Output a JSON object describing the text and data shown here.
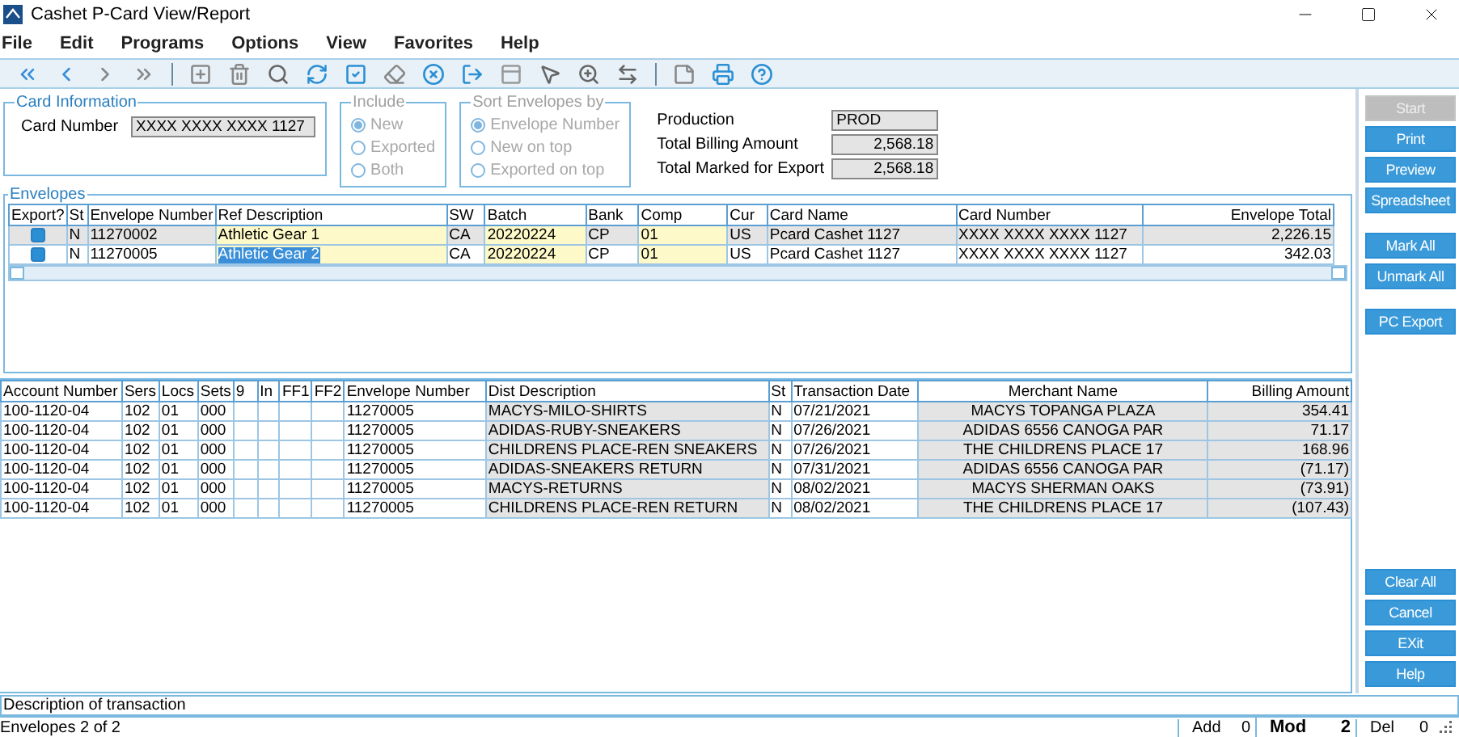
{
  "window": {
    "title": "Cashet P-Card View/Report"
  },
  "menu": [
    "File",
    "Edit",
    "Programs",
    "Options",
    "View",
    "Favorites",
    "Help"
  ],
  "card_information": {
    "title": "Card Information",
    "label": "Card Number",
    "value": "XXXX XXXX XXXX 1127"
  },
  "include": {
    "title": "Include",
    "disabled": true,
    "options": [
      {
        "label": "New",
        "selected": true
      },
      {
        "label": "Exported",
        "selected": false
      },
      {
        "label": "Both",
        "selected": false
      }
    ]
  },
  "sort": {
    "title": "Sort Envelopes by",
    "disabled": true,
    "options": [
      {
        "label": "Envelope Number",
        "selected": true
      },
      {
        "label": "New on top",
        "selected": false
      },
      {
        "label": "Exported on top",
        "selected": false
      }
    ]
  },
  "summary": [
    {
      "label": "Production",
      "value": "PROD"
    },
    {
      "label": "Total Billing Amount",
      "value": "2,568.18"
    },
    {
      "label": "Total Marked for Export",
      "value": "2,568.18"
    }
  ],
  "envelopes": {
    "title": "Envelopes",
    "columns": [
      {
        "label": "Export?",
        "editable": false
      },
      {
        "label": "St",
        "editable": false
      },
      {
        "label": "Envelope Number",
        "editable": false
      },
      {
        "label": "Ref Description",
        "editable": true
      },
      {
        "label": "SW",
        "editable": false
      },
      {
        "label": "Batch",
        "editable": true
      },
      {
        "label": "Bank",
        "editable": false
      },
      {
        "label": "Comp",
        "editable": true
      },
      {
        "label": "Cur",
        "editable": false
      },
      {
        "label": "Card Name",
        "editable": false
      },
      {
        "label": "Card Number",
        "editable": false
      },
      {
        "label": "Envelope Total",
        "editable": false
      }
    ],
    "rows": [
      {
        "selected": false,
        "export": true,
        "cells": [
          "",
          "N",
          "11270002",
          "Athletic Gear 1",
          "CA",
          "20220224",
          "CP",
          "01",
          "US",
          "Pcard Cashet 1127",
          "XXXX XXXX XXXX 1127",
          "2,226.15"
        ]
      },
      {
        "selected": true,
        "export": true,
        "cells": [
          "",
          "N",
          "11270005",
          "Athletic Gear 2",
          "CA",
          "20220224",
          "CP",
          "01",
          "US",
          "Pcard Cashet 1127",
          "XXXX XXXX XXXX 1127",
          "342.03"
        ]
      }
    ]
  },
  "distributions": {
    "columns": [
      {
        "label": "Account Number",
        "shaded": false
      },
      {
        "label": "Sers",
        "shaded": false
      },
      {
        "label": "Locs",
        "shaded": false
      },
      {
        "label": "Sets",
        "shaded": false
      },
      {
        "label": "9",
        "shaded": false
      },
      {
        "label": "In",
        "shaded": false
      },
      {
        "label": "FF1",
        "shaded": false
      },
      {
        "label": "FF2",
        "shaded": false
      },
      {
        "label": "Envelope Number",
        "shaded": false
      },
      {
        "label": "Dist Description",
        "shaded": true
      },
      {
        "label": "St",
        "shaded": false
      },
      {
        "label": "Transaction Date",
        "shaded": false
      },
      {
        "label": "Merchant Name",
        "shaded": true
      },
      {
        "label": "Billing Amount",
        "shaded": true
      }
    ],
    "rows": [
      [
        "100-1120-04",
        "102",
        "01",
        "000",
        "",
        "",
        "",
        "",
        "11270005",
        "MACYS-MILO-SHIRTS",
        "N",
        "07/21/2021",
        "MACYS  TOPANGA PLAZA",
        "354.41"
      ],
      [
        "100-1120-04",
        "102",
        "01",
        "000",
        "",
        "",
        "",
        "",
        "11270005",
        "ADIDAS-RUBY-SNEAKERS",
        "N",
        "07/26/2021",
        "ADIDAS 6556 CANOGA PAR",
        "71.17"
      ],
      [
        "100-1120-04",
        "102",
        "01",
        "000",
        "",
        "",
        "",
        "",
        "11270005",
        "CHILDRENS PLACE-REN SNEAKERS",
        "N",
        "07/26/2021",
        "THE CHILDRENS PLACE 17",
        "168.96"
      ],
      [
        "100-1120-04",
        "102",
        "01",
        "000",
        "",
        "",
        "",
        "",
        "11270005",
        "ADIDAS-SNEAKERS RETURN",
        "N",
        "07/31/2021",
        "ADIDAS 6556 CANOGA PAR",
        "(71.17)"
      ],
      [
        "100-1120-04",
        "102",
        "01",
        "000",
        "",
        "",
        "",
        "",
        "11270005",
        "MACYS-RETURNS",
        "N",
        "08/02/2021",
        "MACYS  SHERMAN OAKS",
        "(73.91)"
      ],
      [
        "100-1120-04",
        "102",
        "01",
        "000",
        "",
        "",
        "",
        "",
        "11270005",
        "CHILDRENS PLACE-REN RETURN",
        "N",
        "08/02/2021",
        "THE CHILDRENS PLACE 17",
        "(107.43)"
      ]
    ]
  },
  "button_groups": [
    [
      {
        "label": "Start",
        "disabled": true
      },
      {
        "label": "Print",
        "disabled": false
      },
      {
        "label": "Preview",
        "disabled": false
      },
      {
        "label": "Spreadsheet",
        "disabled": false
      }
    ],
    [
      {
        "label": "Mark All",
        "disabled": false
      },
      {
        "label": "Unmark All",
        "disabled": false
      }
    ],
    [
      {
        "label": "PC Export",
        "disabled": false
      }
    ]
  ],
  "bottom_buttons": [
    {
      "label": "Clear All",
      "disabled": false
    },
    {
      "label": "Cancel",
      "disabled": false
    },
    {
      "label": "EXit",
      "disabled": false
    },
    {
      "label": "Help",
      "disabled": false
    }
  ],
  "description_bar": "Description of transaction",
  "status_bar": {
    "text": "Envelopes 2 of 2",
    "counters": [
      {
        "label": "Add",
        "value": "0",
        "active": false
      },
      {
        "label": "Mod",
        "value": "2",
        "active": true
      },
      {
        "label": "Del",
        "value": "0",
        "active": false
      }
    ]
  }
}
